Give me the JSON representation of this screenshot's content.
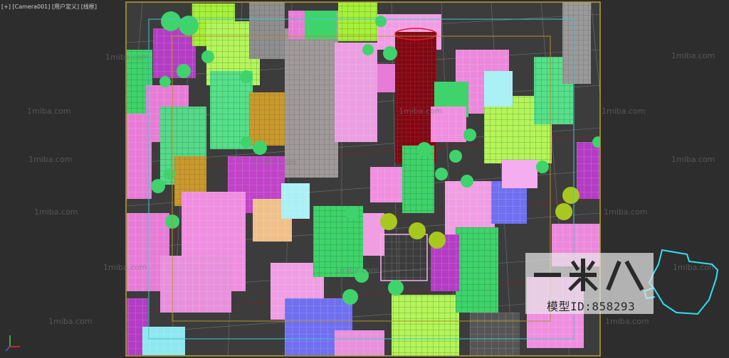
{
  "viewport": {
    "label": "[+] [Camera001] [用户定义] [线框]"
  },
  "watermarks": [
    "1miba.com",
    "1miba.com",
    "1miba.com",
    "1miba.com",
    "1miba.com",
    "1miba.com",
    "1miba.com",
    "1miba.com",
    "1miba.com",
    "1miba.com",
    "1miba.com",
    "1miba.com",
    "1miba.com",
    "1miba.com",
    "1miba.com"
  ],
  "logo": {
    "brand": "一米八",
    "model_id": "模型ID:858293"
  },
  "colors": {
    "background": "#2d2d2d",
    "safe_frame_outer": "#b8a230",
    "safe_frame_action": "#3fc7d0",
    "safe_frame_title": "#b38f2a",
    "viewcube": "#2fe0f0",
    "pink": "#e77cd6",
    "green": "#3fd36b",
    "lime": "#a8f03a",
    "magenta": "#b43cc4",
    "gray": "#9a9a9a",
    "red": "#b01020",
    "tan": "#d8a84a",
    "blue": "#6f6ff0",
    "peach": "#f0c08a"
  }
}
